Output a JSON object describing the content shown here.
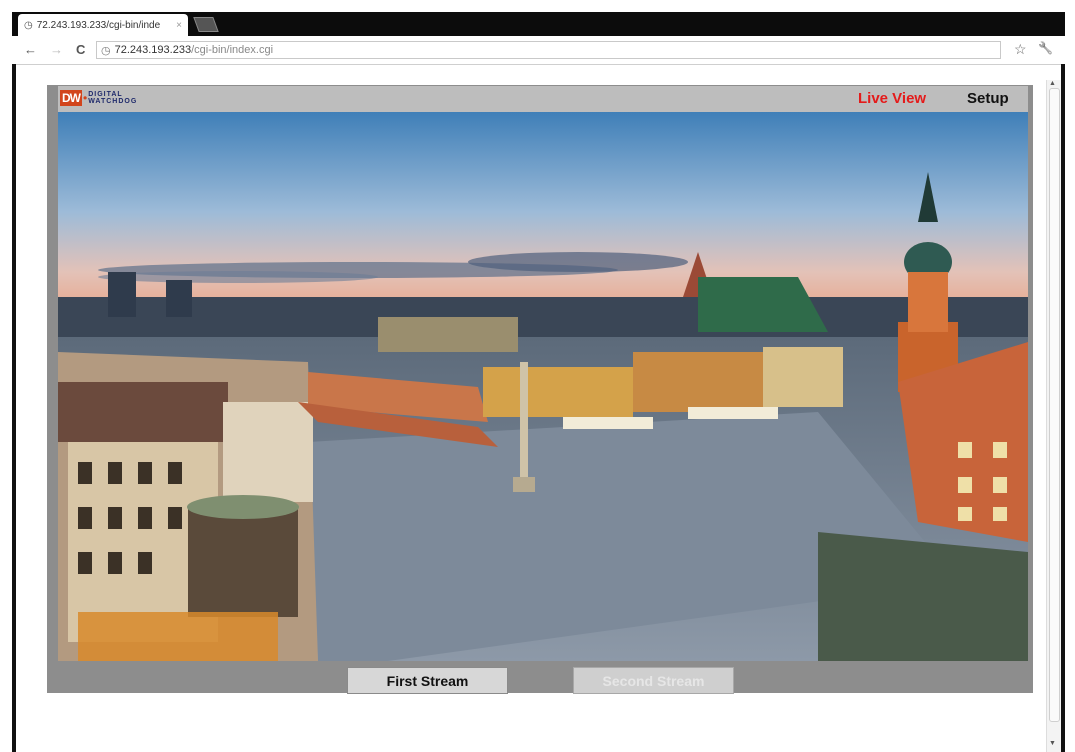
{
  "browser": {
    "tab_title": "72.243.193.233/cgi-bin/inde",
    "tab_close": "×",
    "nav_back": "←",
    "nav_forward": "→",
    "nav_reload": "C",
    "url_host": "72.243.193.233",
    "url_path": "/cgi-bin/index.cgi",
    "bookmark_star": "☆",
    "wrench": "🔧",
    "scroll_up": "▲",
    "scroll_down": "▼"
  },
  "camera": {
    "logo_mark": "DW",
    "logo_dot": "•",
    "logo_text_1": "DIGITAL",
    "logo_text_2": "WATCHDOG",
    "nav": {
      "live_view": "Live View",
      "setup": "Setup"
    },
    "colors": {
      "live_view_accent": "#e41b1b",
      "logo_brand": "#d2451c"
    },
    "buttons": {
      "first_stream": "First Stream",
      "second_stream": "Second Stream"
    },
    "video": {
      "icon": "live-video-feed"
    }
  }
}
